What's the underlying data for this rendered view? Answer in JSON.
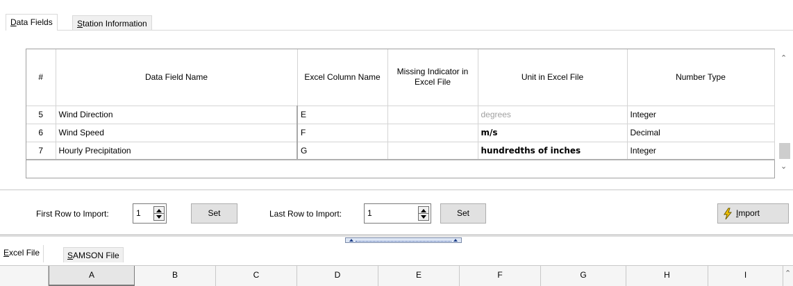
{
  "top_tabs": [
    {
      "label": "Data Fields",
      "active": true
    },
    {
      "label": "Station Information",
      "active": false
    }
  ],
  "grid": {
    "columns": [
      "#",
      "Data Field Name",
      "Excel Column Name",
      "Missing Indicator in Excel File",
      "Unit in Excel File",
      "Number Type"
    ],
    "rows": [
      {
        "num": "5",
        "field": "Wind Direction",
        "col": "E",
        "missing": "",
        "unit": "degrees",
        "type": "Integer"
      },
      {
        "num": "6",
        "field": "Wind Speed",
        "col": "F",
        "missing": "",
        "unit": "m/s",
        "type": "Decimal"
      },
      {
        "num": "7",
        "field": "Hourly Precipitation",
        "col": "G",
        "missing": "",
        "unit": "hundredths of inches",
        "type": "Integer"
      }
    ]
  },
  "controls": {
    "first_row_label": "First Row to Import:",
    "first_row_value": "1",
    "first_set": "Set",
    "last_row_label": "Last Row to Import:",
    "last_row_value": "1",
    "last_set": "Set",
    "import": "Import"
  },
  "bottom_tabs": [
    {
      "label": "Excel File",
      "active": true
    },
    {
      "label": "SAMSON File",
      "active": false
    }
  ],
  "sheet_columns": [
    "A",
    "B",
    "C",
    "D",
    "E",
    "F",
    "G",
    "H",
    "I"
  ],
  "colors": {
    "placeholder_text": "#a0a0a0",
    "button_bg": "#e1e1e1",
    "lightning": "#f2c200"
  },
  "icons": {
    "import": "lightning-icon"
  }
}
